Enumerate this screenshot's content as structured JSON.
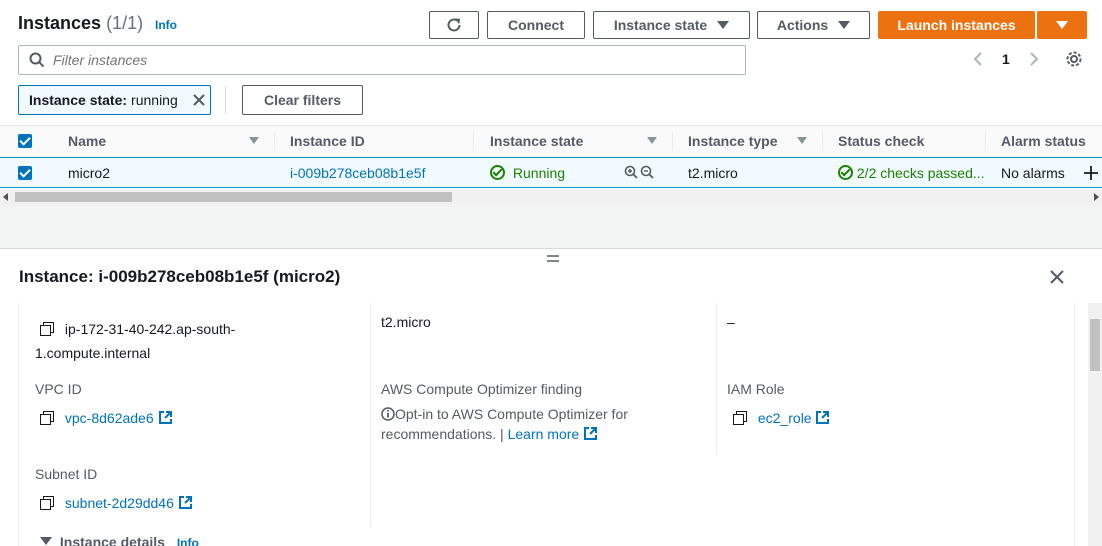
{
  "header": {
    "title": "Instances",
    "count": "(1/1)",
    "info": "Info",
    "buttons": {
      "connect": "Connect",
      "instance_state": "Instance state",
      "actions": "Actions",
      "launch": "Launch instances"
    }
  },
  "search": {
    "placeholder": "Filter instances"
  },
  "pagination": {
    "page": "1"
  },
  "filter_chip": {
    "key": "Instance state:",
    "value": "running"
  },
  "clear_filters": "Clear filters",
  "table": {
    "columns": [
      "Name",
      "Instance ID",
      "Instance state",
      "Instance type",
      "Status check",
      "Alarm status"
    ],
    "row": {
      "name": "micro2",
      "instance_id": "i-009b278ceb08b1e5f",
      "state": "Running",
      "type": "t2.micro",
      "status_check": "2/2 checks passed...",
      "alarm": "No alarms"
    }
  },
  "detail": {
    "title": "Instance: i-009b278ceb08b1e5f (micro2)",
    "dns_line1": "ip-172-31-40-242.ap-south-",
    "dns_line2": "1.compute.internal",
    "instance_type": "t2.micro",
    "dash": "–",
    "vpc_label": "VPC ID",
    "vpc_value": "vpc-8d62ade6",
    "optimizer_label": "AWS Compute Optimizer finding",
    "optimizer_line1": "Opt-in to AWS Compute Optimizer for",
    "optimizer_line2": "recommendations. |",
    "learn_more": "Learn more",
    "iam_label": "IAM Role",
    "iam_value": "ec2_role",
    "subnet_label": "Subnet ID",
    "subnet_value": "subnet-2d29dd46",
    "section_title": "Instance details",
    "section_info": "Info"
  },
  "colors": {
    "accent": "#ec7211",
    "link": "#0073bb",
    "success": "#1d8102",
    "selected_bg": "#f1faff"
  }
}
